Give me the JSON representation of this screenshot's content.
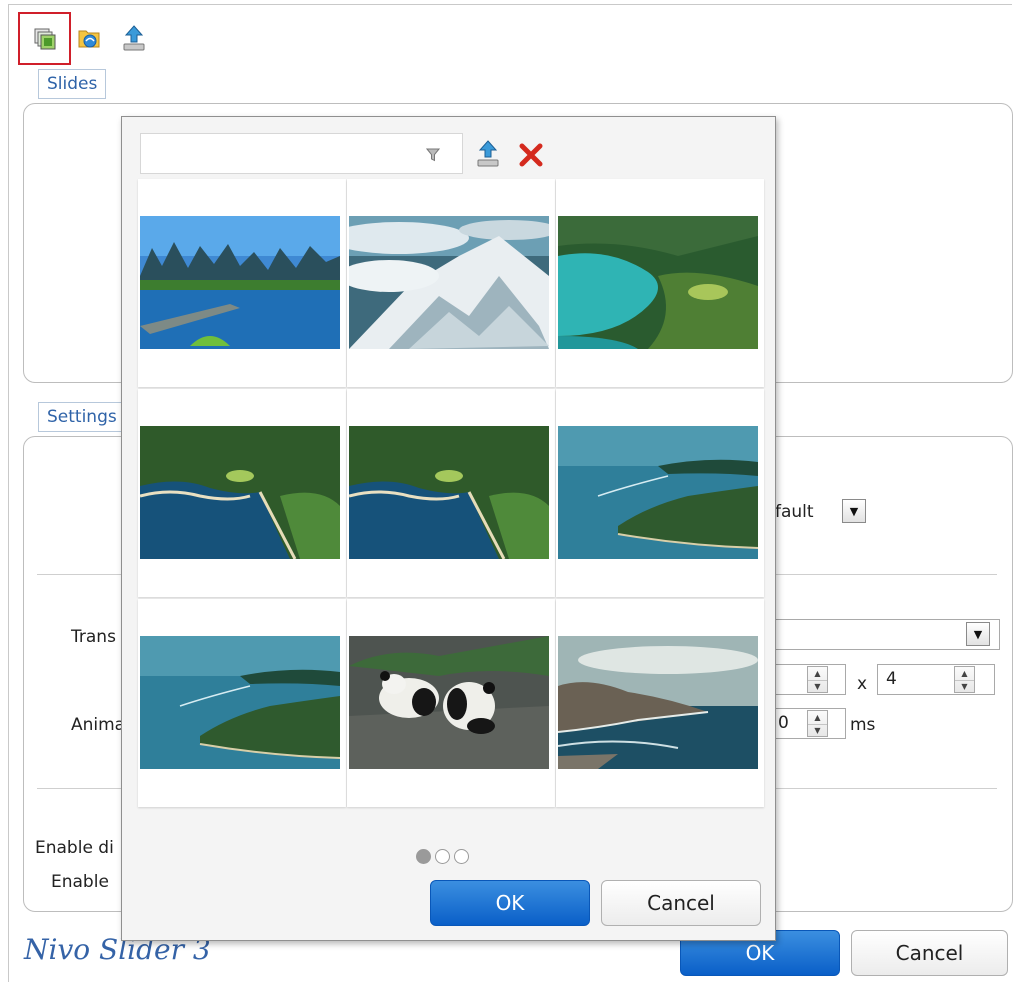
{
  "toolbar": {
    "icons": [
      "add-slide-icon",
      "image-library-icon",
      "upload-icon"
    ]
  },
  "sections": {
    "slides_label": "Slides",
    "settings_label": "Settings"
  },
  "settings": {
    "theme_value": "fault",
    "transition_label": "Trans",
    "transition_value": "",
    "grid_x_value": "",
    "grid_times": "x",
    "grid_y_value": "4",
    "animation_label": "Anima",
    "animation_value": "0",
    "animation_unit": "ms",
    "enable_1_label": "Enable di",
    "enable_2_label": "Enable"
  },
  "footer": {
    "title": "Nivo Slider 3",
    "ok_label": "OK",
    "cancel_label": "Cancel"
  },
  "picker": {
    "filter_placeholder": "",
    "images": [
      {
        "name": "karst-mountains-lake"
      },
      {
        "name": "snowy-mountain-peak"
      },
      {
        "name": "coastal-lagoon"
      },
      {
        "name": "green-bay-aerial"
      },
      {
        "name": "green-bay-aerial-2"
      },
      {
        "name": "island-boat-sea"
      },
      {
        "name": "island-boat-sea-2"
      },
      {
        "name": "pandas-on-rock"
      },
      {
        "name": "rocky-coastline"
      }
    ],
    "pages": 3,
    "current_page": 1,
    "ok_label": "OK",
    "cancel_label": "Cancel"
  },
  "colors": {
    "accent": "#0a5fc8",
    "label_blue": "#2f63a8",
    "selected_outline": "#d01f2a",
    "delete_red": "#d42a1e"
  }
}
